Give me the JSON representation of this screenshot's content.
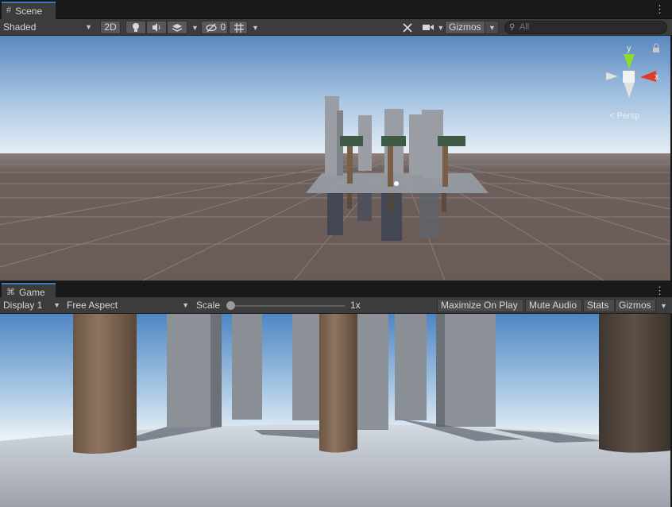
{
  "scene": {
    "tab_label": "Scene",
    "tab_icon": "grid-icon",
    "shading_mode": "Shaded",
    "toggle_2d": "2D",
    "hidden_count": "0",
    "gizmos_label": "Gizmos",
    "search_placeholder": "All",
    "orientation_gizmo": {
      "y_label": "y",
      "x_label": "x",
      "projection_label": "< Persp"
    }
  },
  "game": {
    "tab_label": "Game",
    "tab_icon": "gamepad-icon",
    "display": "Display 1",
    "aspect": "Free Aspect",
    "scale_label": "Scale",
    "scale_value": "1x",
    "scale_fraction": 0.0,
    "maximize_on_play": "Maximize On Play",
    "mute_audio": "Mute Audio",
    "stats": "Stats",
    "gizmos_label": "Gizmos"
  },
  "colors": {
    "accent": "#3a79bb",
    "panel": "#3c3c3c",
    "sky_top": "#5a88bf",
    "sky_horizon": "#e4eef6",
    "ground": "#6e605c",
    "axis_x": "#e03a2a",
    "axis_y": "#8fdc2c",
    "trunk": "#7a5f47",
    "foliage": "#3e5a46"
  }
}
